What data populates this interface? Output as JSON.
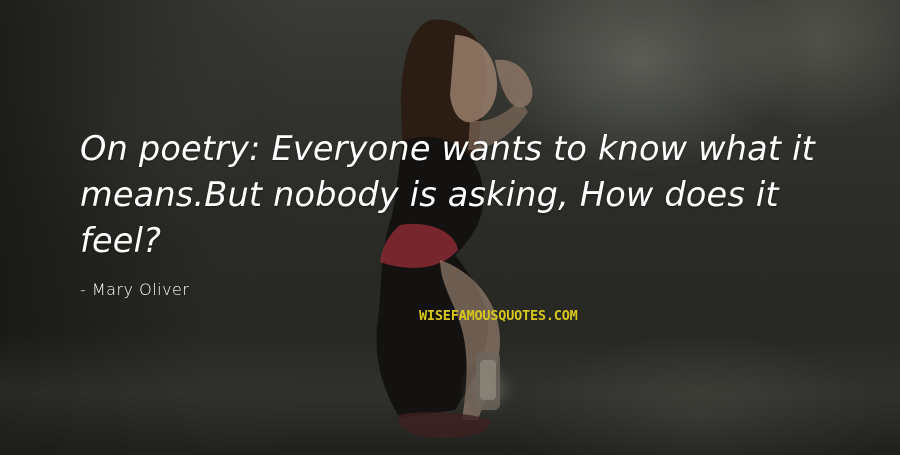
{
  "quote": {
    "text": "On poetry: Everyone wants to know what it means.But nobody is asking, How does it feel?",
    "author": "- Mary Oliver"
  },
  "watermark": {
    "text": "WISEFAMOUSQUOTES.COM",
    "color": "#d8c71b"
  },
  "background": {
    "description_icon": "woman-crouching-photo"
  }
}
